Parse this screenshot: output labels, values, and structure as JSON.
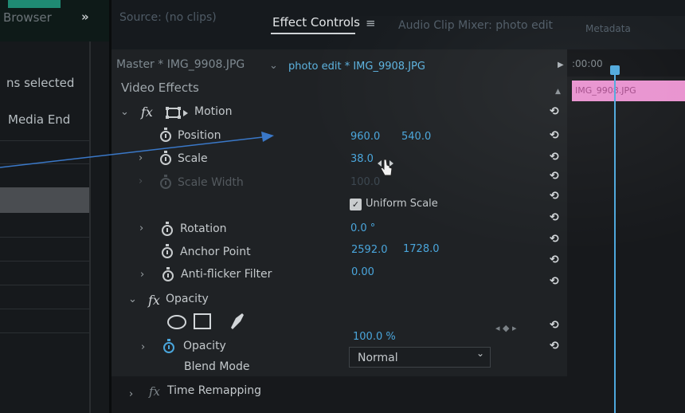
{
  "left_panel": {
    "tab_label": "Browser",
    "chevron": "»",
    "items_selected": "ns selected",
    "media_end": "Media End"
  },
  "tabs": {
    "source": "Source: (no clips)",
    "effect_controls": "Effect Controls",
    "effect_controls_menu": "≡",
    "audio_mixer": "Audio Clip Mixer: photo edit",
    "metadata": "Metadata"
  },
  "header": {
    "master": "Master * IMG_9908.JPG",
    "master_chevron": "⌄",
    "clip": "photo edit * IMG_9908.JPG"
  },
  "section_title": "Video Effects",
  "motion": {
    "fx": "fx",
    "name": "Motion",
    "position": {
      "label": "Position",
      "x": "960.0",
      "y": "540.0"
    },
    "scale": {
      "label": "Scale",
      "value": "38.0"
    },
    "scale_width": {
      "label": "Scale Width",
      "value": "100.0"
    },
    "uniform_scale": {
      "label": "Uniform Scale",
      "checked": true
    },
    "rotation": {
      "label": "Rotation",
      "value": "0.0 °"
    },
    "anchor_point": {
      "label": "Anchor Point",
      "x": "2592.0",
      "y": "1728.0"
    },
    "anti_flicker": {
      "label": "Anti-flicker Filter",
      "value": "0.00"
    }
  },
  "opacity": {
    "fx": "fx",
    "name": "Opacity",
    "property": {
      "label": "Opacity",
      "value": "100.0 %"
    },
    "blend_mode": {
      "label": "Blend Mode",
      "value": "Normal"
    }
  },
  "time_remapping": {
    "fx": "fx",
    "name": "Time Remapping"
  },
  "timeline": {
    "timecode": ":00:00",
    "clip_label": "IMG_9908.JPG"
  },
  "icons": {
    "reset": "⟲",
    "twirl_closed": "›",
    "twirl_open": "⌄"
  },
  "colors": {
    "accent_blue": "#4aa6dc",
    "clip_pink": "#e892cf",
    "panel_bg": "#1f2225"
  }
}
